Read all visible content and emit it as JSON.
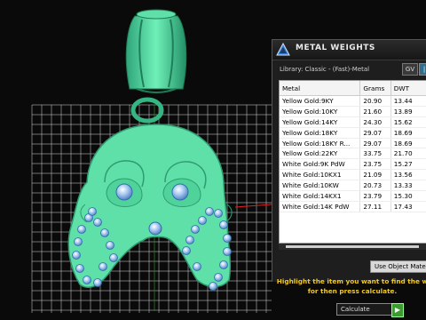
{
  "panel": {
    "title": "METAL WEIGHTS",
    "library_label": "Library: Classic - (Fast)-Metal",
    "gv_button": "GV",
    "columns": [
      "Metal",
      "Grams",
      "DWT"
    ],
    "rows": [
      [
        "Yellow Gold:9KY",
        "20.90",
        "13.44"
      ],
      [
        "Yellow Gold:10KY",
        "21.60",
        "13.89"
      ],
      [
        "Yellow Gold:14KY",
        "24.30",
        "15.62"
      ],
      [
        "Yellow Gold:18KY",
        "29.07",
        "18.69"
      ],
      [
        "Yellow Gold:18KY R...",
        "29.07",
        "18.69"
      ],
      [
        "Yellow Gold:22KY",
        "33.75",
        "21.70"
      ],
      [
        "White Gold:9K PdW",
        "23.75",
        "15.27"
      ],
      [
        "White Gold:10KX1",
        "21.09",
        "13.56"
      ],
      [
        "White Gold:10KW",
        "20.73",
        "13.33"
      ],
      [
        "White Gold:14KX1",
        "23.79",
        "15.30"
      ],
      [
        "White Gold:14K PdW",
        "27.11",
        "17.43"
      ]
    ],
    "use_object_material": "Use Object Material",
    "hint_line1": "Highlight the item you want to find the w",
    "hint_line2": "for then press calculate.",
    "calculate": "Calculate"
  },
  "colors": {
    "pendant": "#5fe0a8",
    "pendant_dark": "#2f9b72",
    "gem": "#8fb6e8",
    "hint": "#f2c81e",
    "grid": "#ffffff"
  }
}
